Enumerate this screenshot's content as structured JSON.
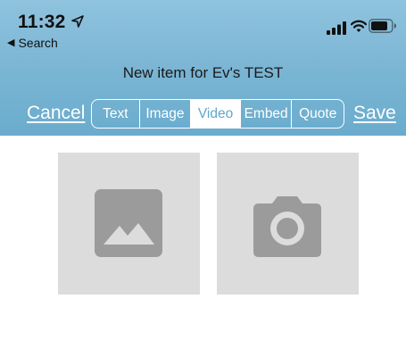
{
  "status_bar": {
    "time": "11:32",
    "back_label": "Search",
    "icons": [
      "location-arrow-icon",
      "signal-bars-icon",
      "wifi-icon",
      "battery-icon"
    ]
  },
  "nav": {
    "title": "New item for Ev's TEST",
    "cancel_label": "Cancel",
    "save_label": "Save"
  },
  "segments": {
    "items": [
      "Text",
      "Image",
      "Video",
      "Embed",
      "Quote"
    ],
    "selected": "Video"
  },
  "media_options": {
    "icons": [
      "photo-library-icon",
      "camera-icon"
    ]
  },
  "colors": {
    "header_gradient_top": "#8fc3de",
    "header_gradient_bottom": "#6aaccd",
    "tile_background": "#dcdcdc",
    "icon_gray": "#9b9b9b",
    "active_segment_text": "#5fa7cc"
  }
}
